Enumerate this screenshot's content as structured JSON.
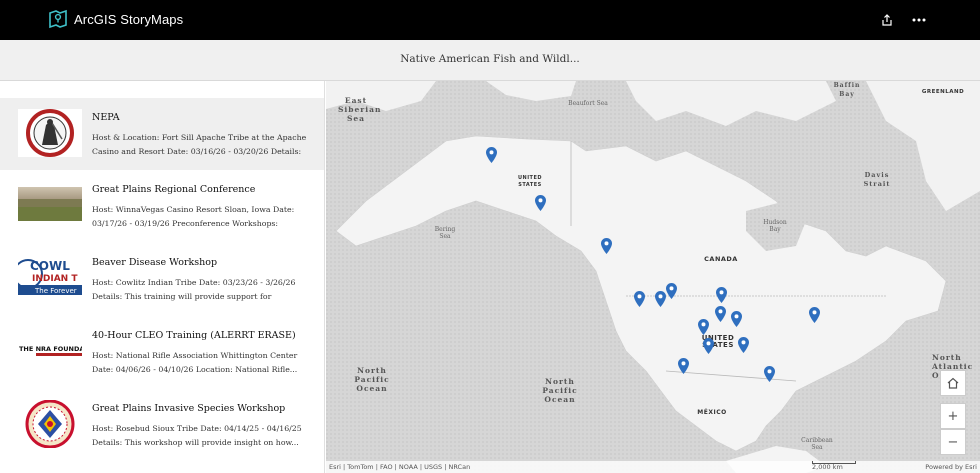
{
  "header": {
    "brand": "ArcGIS StoryMaps",
    "icons": [
      "storymaps-logo-icon",
      "share-icon",
      "more-options-icon"
    ]
  },
  "title": "Native American Fish and Wildl...",
  "sidebar": {
    "items": [
      {
        "title": "NEPA",
        "desc": "Host & Location: Fort Sill Apache Tribe at the Apache Casino and Resort Date: 03/16/26 - 03/20/26 Details: T...",
        "thumb": "fort-sill-apache-seal"
      },
      {
        "title": "Great Plains Regional Conference",
        "desc": "Host: WinnaVegas Casino Resort Sloan, Iowa Date: 03/17/26 - 03/19/26 Preconference Workshops: 03/15/2...",
        "thumb": "prairie-landscape"
      },
      {
        "title": "Beaver Disease Workshop",
        "desc": "Host: Cowlitz Indian Tribe Date: 03/23/26 - 3/26/26 Details: This training will provide support for beaver...",
        "thumb": "cowlitz-logo",
        "thumb_text1": "COWL",
        "thumb_text2": "INDIAN T",
        "thumb_text3": "The Forever"
      },
      {
        "title": "40-Hour CLEO Training (ALERRT ERASE)",
        "desc": "Host: National Rifle Association Whittington Center Date: 04/06/26 - 04/10/26 Location: National Rifle...",
        "thumb": "nra-logo",
        "thumb_text1": "THE NRA FOUNDATION"
      },
      {
        "title": "Great Plains Invasive Species Workshop",
        "desc": "Host: Rosebud Sioux Tribe Date: 04/14/25 - 04/16/25 Details: This workshop will provide insight on how...",
        "thumb": "rosebud-sioux-seal"
      }
    ]
  },
  "map": {
    "labels": {
      "east_siberian": "East Siberian Sea",
      "beaufort": "Beaufort Sea",
      "baffin": "Baffin Bay",
      "greenland": "GREENLAND",
      "united_states_ak": "UNITED STATES",
      "bering": "Bering Sea",
      "davis": "Davis Strait",
      "hudson": "Hudson Bay",
      "canada": "CANADA",
      "united_states": "UNITED STATES",
      "north_pacific_left": "North Pacific Ocean",
      "north_pacific_mid": "North Pacific Ocean",
      "north_atlantic": "North Atlantic O",
      "mexico": "MÉXICO",
      "caribbean": "Caribbean Sea"
    },
    "controls": {
      "home": "home-icon",
      "zoom_in": "+",
      "zoom_out": "−"
    },
    "attribution": "Esri | TomTom | FAO | NOAA | USGS | NRCan",
    "scale": "2,000 km",
    "powered_by": "Powered by Esri",
    "pin_color": "#2f6fbf"
  }
}
